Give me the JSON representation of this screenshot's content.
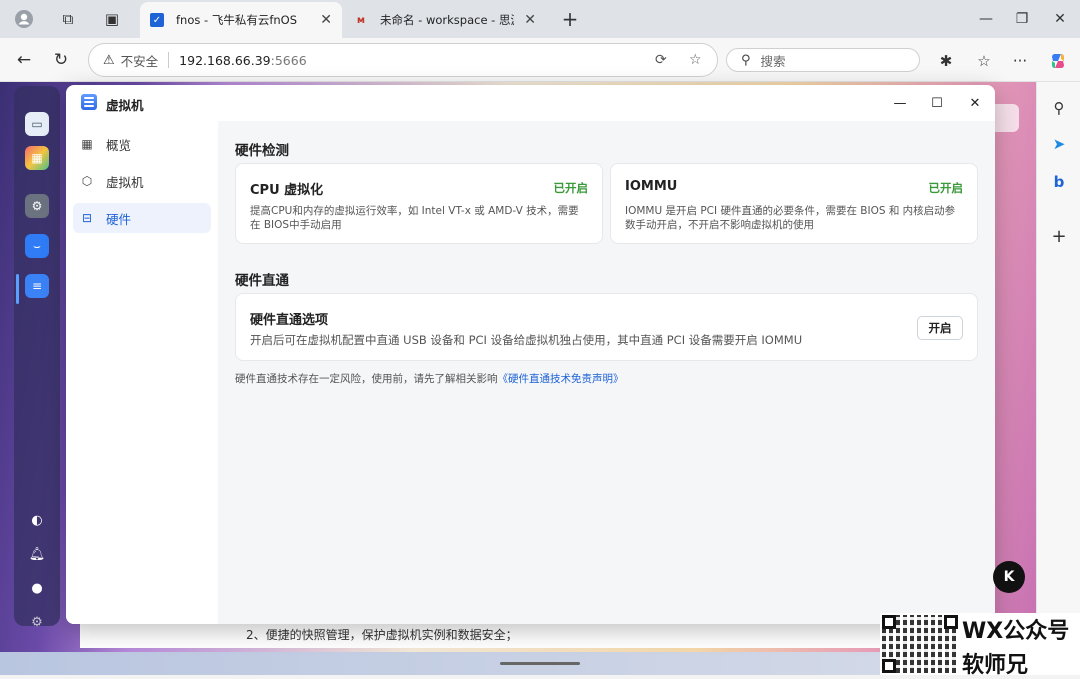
{
  "browser": {
    "tabs": [
      {
        "title": "fnos - 飞牛私有云fnOS",
        "active": true
      },
      {
        "title": "未命名 - workspace - 思源笔",
        "active": false
      }
    ],
    "address": {
      "insecure_label": "不安全",
      "host": "192.168.66.39",
      "port": ":5666"
    },
    "search_placeholder": "搜索"
  },
  "window": {
    "title": "虚拟机",
    "nav": [
      {
        "label": "概览",
        "icon": "grid-icon"
      },
      {
        "label": "虚拟机",
        "icon": "cube-icon"
      },
      {
        "label": "硬件",
        "icon": "drive-icon",
        "selected": true
      }
    ]
  },
  "hardware_check": {
    "section_title": "硬件检测",
    "cards": [
      {
        "title": "CPU 虚拟化",
        "status": "已开启",
        "description": "提高CPU和内存的虚拟运行效率，如 Intel VT-x 或 AMD-V 技术，需要在 BIOS中手动启用"
      },
      {
        "title": "IOMMU",
        "status": "已开启",
        "description": "IOMMU 是开启 PCI 硬件直通的必要条件，需要在 BIOS 和 内核启动参数手动开启，不开启不影响虚拟机的使用"
      }
    ]
  },
  "passthrough": {
    "section_title": "硬件直通",
    "option_title": "硬件直通选项",
    "option_desc": "开启后可在虚拟机配置中直通 USB 设备和 PCI 设备给虚拟机独占使用，其中直通 PCI 设备需要开启 IOMMU",
    "button_label": "开启",
    "note_prefix": "硬件直通技术存在一定风险，使用前，请先了解相关影响",
    "note_link": "《硬件直通技术免责声明》"
  },
  "background": {
    "behind_text": "2、便捷的快照管理，保护虚拟机实例和数据安全；"
  },
  "badge_letter": "K",
  "watermark": {
    "line1": "WX公众号",
    "line2": "软师兄"
  },
  "colors": {
    "accent": "#1f63d6",
    "status_on": "#3a9a3a"
  }
}
